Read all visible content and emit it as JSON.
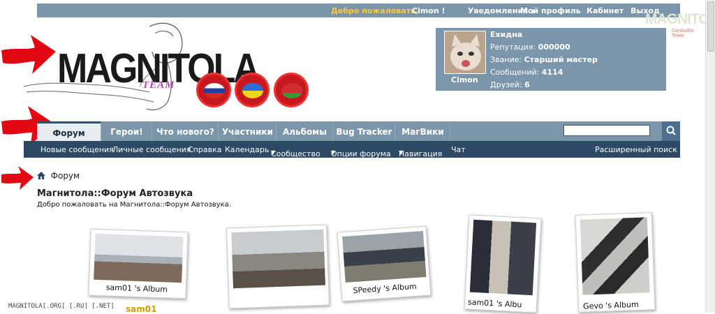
{
  "topbar": {
    "welcome": "Добро пожаловать,",
    "username": "Cimon !",
    "notifications": "Уведомления",
    "profile": "Мой профиль",
    "cabinet": "Кабинет",
    "logout": "Выход"
  },
  "corner_logo": {
    "text": "MAGNITOLA",
    "sub": "CarAudio Team"
  },
  "logo": {
    "text": "MAGNITOLA",
    "team": "TEAM"
  },
  "badges": [
    {
      "flag": "russia"
    },
    {
      "flag": "ukraine"
    },
    {
      "flag": "belarus"
    }
  ],
  "userbox": {
    "name": "Ехидна",
    "avatar_name": "Cimon",
    "rows": [
      {
        "label": "Репутация:",
        "value": "000000"
      },
      {
        "label": "Звание:",
        "value": "Старший мастер"
      },
      {
        "label": "Сообщений:",
        "value": "4114"
      },
      {
        "label": "Друзей:",
        "value": "6"
      }
    ]
  },
  "nav": {
    "tabs": [
      "Форум",
      "Герои!",
      "Что нового?",
      "Участники",
      "Альбомы",
      "Bug Tracker",
      "МагВики"
    ],
    "active": "Форум",
    "search_placeholder": ""
  },
  "subnav": {
    "items": [
      "Новые сообщения",
      "Личные сообщения",
      "Справка",
      "Календарь",
      "Сообщество",
      "Опции форума",
      "Навигация",
      "Чат"
    ],
    "advanced_search": "Расширенный поиск"
  },
  "breadcrumb": {
    "label": "Форум"
  },
  "forum": {
    "title": "Магнитола::Форум Автозвука",
    "description": "Добро пожаловать на Магнитола::Форум Автозвука."
  },
  "albums": [
    {
      "caption": "sam01 's Album"
    },
    {
      "caption": ""
    },
    {
      "caption": "SPeedy 's Album"
    },
    {
      "caption": "sam01 's Albu"
    },
    {
      "caption": "Gevo 's Album"
    }
  ],
  "status_bar": {
    "text": "MAGNITOLA[.ORG] [.RU] [.NET]",
    "label": "sam01"
  },
  "colors": {
    "bar": "#7b96aa",
    "subnav": "#2c4a66",
    "welcome": "#ffcc33",
    "arrow": "#e30613"
  }
}
